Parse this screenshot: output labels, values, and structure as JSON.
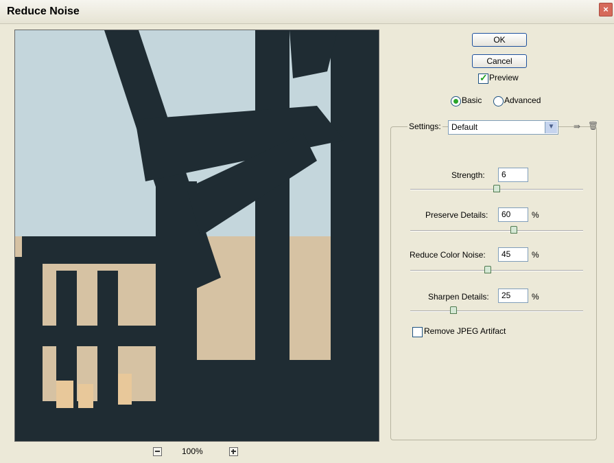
{
  "window": {
    "title": "Reduce Noise",
    "close_glyph": "×"
  },
  "buttons": {
    "ok": "OK",
    "cancel": "Cancel"
  },
  "preview_checkbox": {
    "label": "Preview",
    "checked": true
  },
  "mode": {
    "basic": "Basic",
    "advanced": "Advanced",
    "selected": "Basic"
  },
  "settings": {
    "label": "Settings:",
    "value": "Default"
  },
  "sliders": [
    {
      "label": "Strength:",
      "value": "6",
      "unit": "",
      "fraction": 0.5
    },
    {
      "label": "Preserve Details:",
      "value": "60",
      "unit": "%",
      "fraction": 0.6
    },
    {
      "label": "Reduce Color Noise:",
      "value": "45",
      "unit": "%",
      "fraction": 0.45
    },
    {
      "label": "Sharpen Details:",
      "value": "25",
      "unit": "%",
      "fraction": 0.25
    }
  ],
  "jpeg": {
    "label": "Remove JPEG Artifact",
    "checked": false
  },
  "zoom": {
    "level": "100%"
  },
  "icons": {
    "save": "save-settings-icon",
    "delete": "delete-settings-icon",
    "zoom_out": "zoom-out-icon",
    "zoom_in": "zoom-in-icon"
  }
}
